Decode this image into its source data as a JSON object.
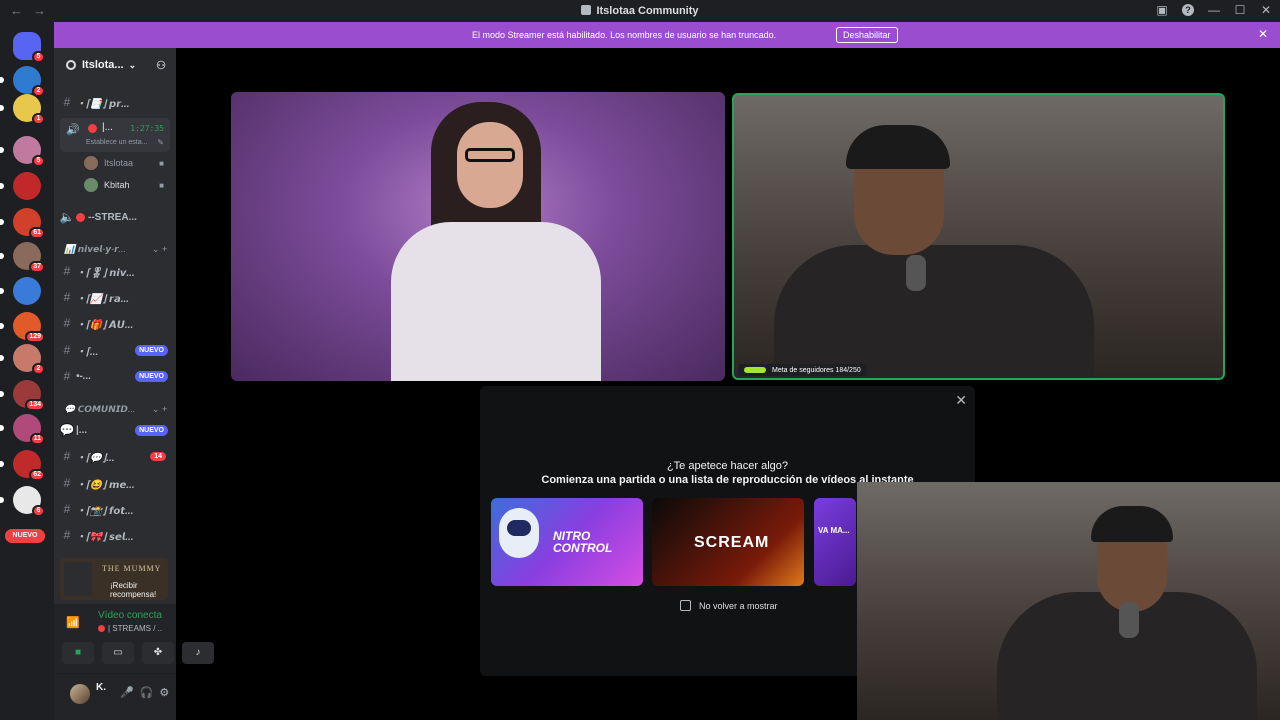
{
  "window": {
    "title": "Itslotaa Community",
    "back_icon": "arrow-left-icon",
    "forward_icon": "arrow-right-icon"
  },
  "banner": {
    "message": "El modo Streamer está habilitado. Los nombres de usuario se han truncado.",
    "button": "Deshabilitar",
    "color": "#9b4dd0"
  },
  "rail": {
    "servers": [
      {
        "color": "#5865f2",
        "badge": "5"
      },
      {
        "color": "#2f7bd0",
        "badge": "2"
      },
      {
        "color": "#e8c84a",
        "badge": "1"
      },
      {
        "color": "#c07aa0",
        "badge": "5"
      },
      {
        "color": "#c0282a",
        "badge": ""
      },
      {
        "color": "#d0402a",
        "badge": "61"
      },
      {
        "color": "#8a6a5a",
        "badge": "37"
      },
      {
        "color": "#3a7ad8",
        "badge": ""
      },
      {
        "color": "#e05a2a",
        "badge": "129"
      },
      {
        "color": "#c87a6a",
        "badge": "2"
      },
      {
        "color": "#9a3a3a",
        "badge": "134"
      },
      {
        "color": "#b04a7a",
        "badge": "11"
      },
      {
        "color": "#c02a2a",
        "badge": "62"
      },
      {
        "color": "#e8e8e8",
        "badge": "6"
      }
    ],
    "nuevo": "NUEVO"
  },
  "sidebar": {
    "server_name": "Itslota...",
    "voice_channel": {
      "name": "|...",
      "timer": "1:27:35",
      "status": "Establece un esta...",
      "users": [
        "Itslotaa",
        "Kbitah"
      ]
    },
    "channels": [
      {
        "name": "・⌈📑⌋ 𝙥𝙧...",
        "tag": "",
        "count": ""
      },
      {
        "name": "--STREA...",
        "tag": "",
        "count": ""
      },
      {
        "name": "・⌈🎖⌋ 𝙣𝙞𝙫...",
        "tag": "",
        "count": ""
      },
      {
        "name": "・⌈📈⌋ 𝙧𝙖...",
        "tag": "",
        "count": ""
      },
      {
        "name": "・⌈🎁⌋ 𝘼𝙐...",
        "tag": "",
        "count": ""
      },
      {
        "name": "・⌈...",
        "tag": "NUEVO",
        "count": ""
      },
      {
        "name": "•-...",
        "tag": "NUEVO",
        "count": ""
      },
      {
        "name": "|...",
        "tag": "NUEVO",
        "count": ""
      },
      {
        "name": "・⌈💬⌋...",
        "tag": "",
        "count": "14"
      },
      {
        "name": "・⌈😆⌋ 𝙢𝙚...",
        "tag": "",
        "count": ""
      },
      {
        "name": "・⌈📸⌋ 𝙛𝙤𝙩...",
        "tag": "",
        "count": ""
      },
      {
        "name": "・⌈🎀⌋ 𝙨𝙚𝙡...",
        "tag": "",
        "count": ""
      }
    ],
    "categories": [
      "📊 𝙣𝙞𝙫𝙚𝙡-𝙮-𝙧...",
      "💬 𝘾𝙊𝙈𝙐𝙉𝙄𝘿..."
    ]
  },
  "promo": {
    "title": "THE MUMMY",
    "cta": "¡Recibir recompensa!"
  },
  "rtc": {
    "status": "Vídeo conectado",
    "channel": "| STREAMS / ..."
  },
  "user": {
    "name": "K."
  },
  "tile2": {
    "goal": "Meta de seguidores 184/250"
  },
  "activity": {
    "question": "¿Te apetece hacer algo?",
    "subtitle": "Comienza una partida o una lista de reproducción de vídeos al instante",
    "cards": [
      "NITRO CONTROL",
      "SCREAM",
      "VA MA..."
    ],
    "checkbox": "No volver a mostrar"
  }
}
